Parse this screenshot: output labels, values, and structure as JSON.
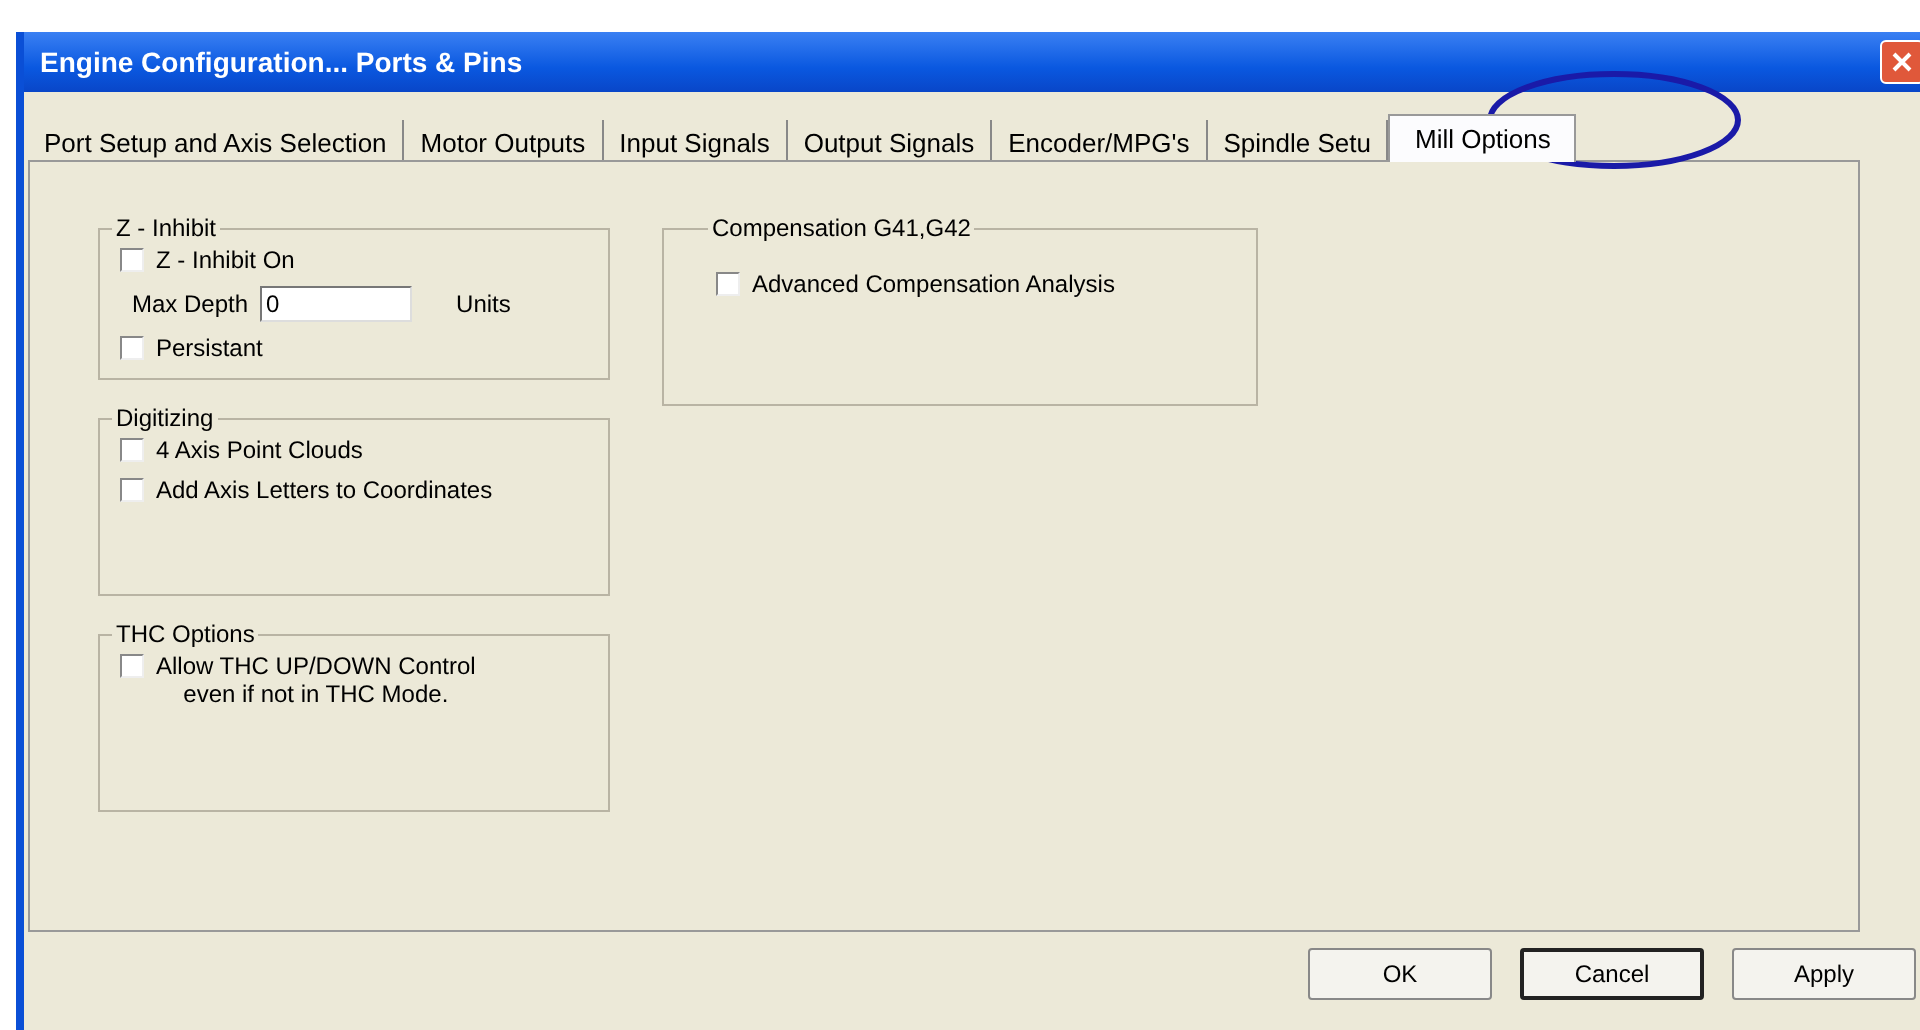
{
  "window": {
    "title": "Engine Configuration... Ports & Pins"
  },
  "tabs": [
    {
      "label": "Port Setup and Axis Selection",
      "selected": false
    },
    {
      "label": "Motor Outputs",
      "selected": false
    },
    {
      "label": "Input Signals",
      "selected": false
    },
    {
      "label": "Output Signals",
      "selected": false
    },
    {
      "label": "Encoder/MPG's",
      "selected": false
    },
    {
      "label": "Spindle Setu",
      "selected": false
    },
    {
      "label": "Mill Options",
      "selected": true
    }
  ],
  "left_groups": [
    {
      "title": "Z - Inhibit",
      "items": [
        {
          "kind": "checkbox",
          "label": "Z - Inhibit On",
          "checked": false
        },
        {
          "kind": "field",
          "label": "Max Depth",
          "value": "0",
          "unit": "Units"
        },
        {
          "kind": "checkbox",
          "label": "Persistant",
          "checked": false
        }
      ]
    },
    {
      "title": "Digitizing",
      "items": [
        {
          "kind": "checkbox",
          "label": "4 Axis Point Clouds",
          "checked": false
        },
        {
          "kind": "checkbox",
          "label": "Add Axis Letters to Coordinates",
          "checked": false
        }
      ]
    },
    {
      "title": "THC Options",
      "items": [
        {
          "kind": "checkbox",
          "label": "Allow THC UP/DOWN Control\neven if not in THC Mode.",
          "checked": false
        }
      ]
    }
  ],
  "right_groups": [
    {
      "title": "Compensation G41,G42",
      "items": [
        {
          "kind": "checkbox",
          "label": "Advanced Compensation Analysis",
          "checked": false
        }
      ]
    }
  ],
  "buttons": [
    {
      "label": "OK",
      "default": false
    },
    {
      "label": "Cancel",
      "default": true
    },
    {
      "label": "Apply",
      "default": false
    }
  ]
}
